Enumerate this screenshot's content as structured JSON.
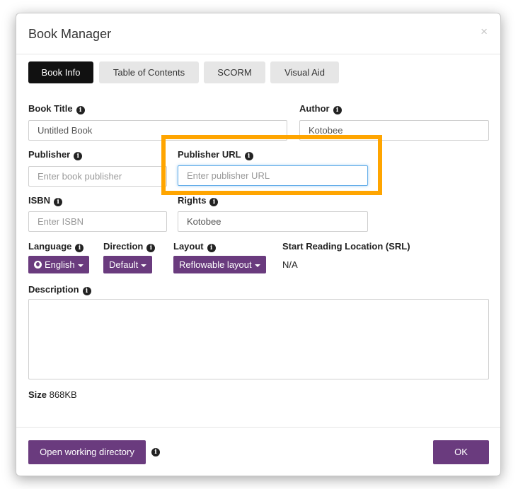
{
  "dialog": {
    "title": "Book Manager",
    "close_label": "×"
  },
  "tabs": [
    {
      "label": "Book Info",
      "active": true
    },
    {
      "label": "Table of Contents"
    },
    {
      "label": "SCORM"
    },
    {
      "label": "Visual Aid"
    }
  ],
  "fields": {
    "book_title": {
      "label": "Book Title",
      "value": "Untitled Book"
    },
    "author": {
      "label": "Author",
      "value": "Kotobee"
    },
    "publisher": {
      "label": "Publisher",
      "placeholder": "Enter book publisher"
    },
    "publisher_url": {
      "label": "Publisher URL",
      "placeholder": "Enter publisher URL"
    },
    "isbn": {
      "label": "ISBN",
      "placeholder": "Enter ISBN"
    },
    "rights": {
      "label": "Rights",
      "value": "Kotobee"
    }
  },
  "options": {
    "language": {
      "label": "Language",
      "value": "English"
    },
    "direction": {
      "label": "Direction",
      "value": "Default"
    },
    "layout": {
      "label": "Layout",
      "value": "Reflowable layout"
    },
    "srl": {
      "label": "Start Reading Location (SRL)",
      "value": "N/A"
    }
  },
  "description": {
    "label": "Description"
  },
  "size": {
    "label": "Size",
    "value": "868KB"
  },
  "footer": {
    "open_dir_label": "Open working directory",
    "ok_label": "OK"
  },
  "icons": {
    "info": "info-icon",
    "language": "globe-icon",
    "dropdown": "caret-down-icon"
  },
  "colors": {
    "accent": "#6a3b7e",
    "highlight": "#ffa500",
    "active_tab": "#111111"
  }
}
